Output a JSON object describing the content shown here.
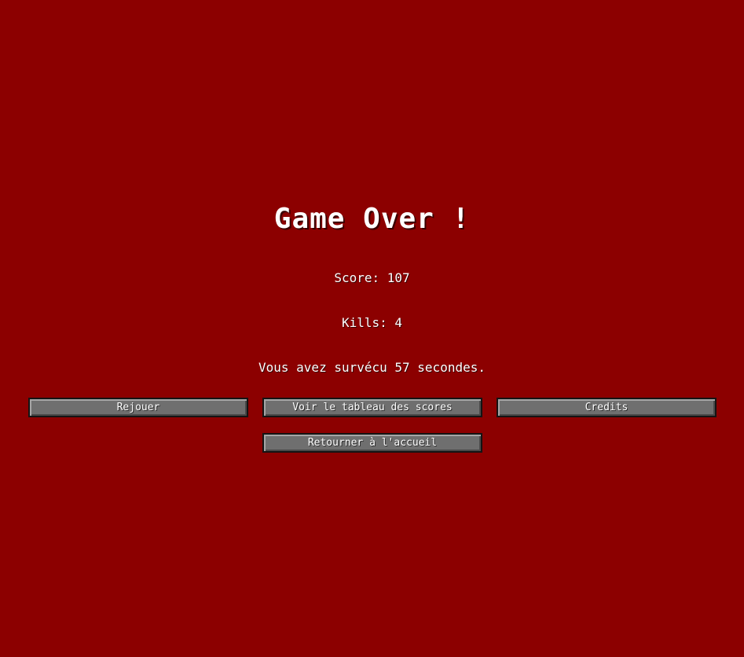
{
  "theme": {
    "background": "#8c0000",
    "button_face": "#6f6f6f",
    "text": "#ffffff"
  },
  "screen": {
    "title": "Game Over !",
    "score_text": "Score: 107",
    "kills_text": "Kills: 4",
    "survived_text": "Vous avez survécu 57 secondes."
  },
  "buttons": {
    "replay": "Rejouer",
    "scores": "Voir le tableau des scores",
    "credits": "Credits",
    "home": "Retourner à l'accueil"
  }
}
